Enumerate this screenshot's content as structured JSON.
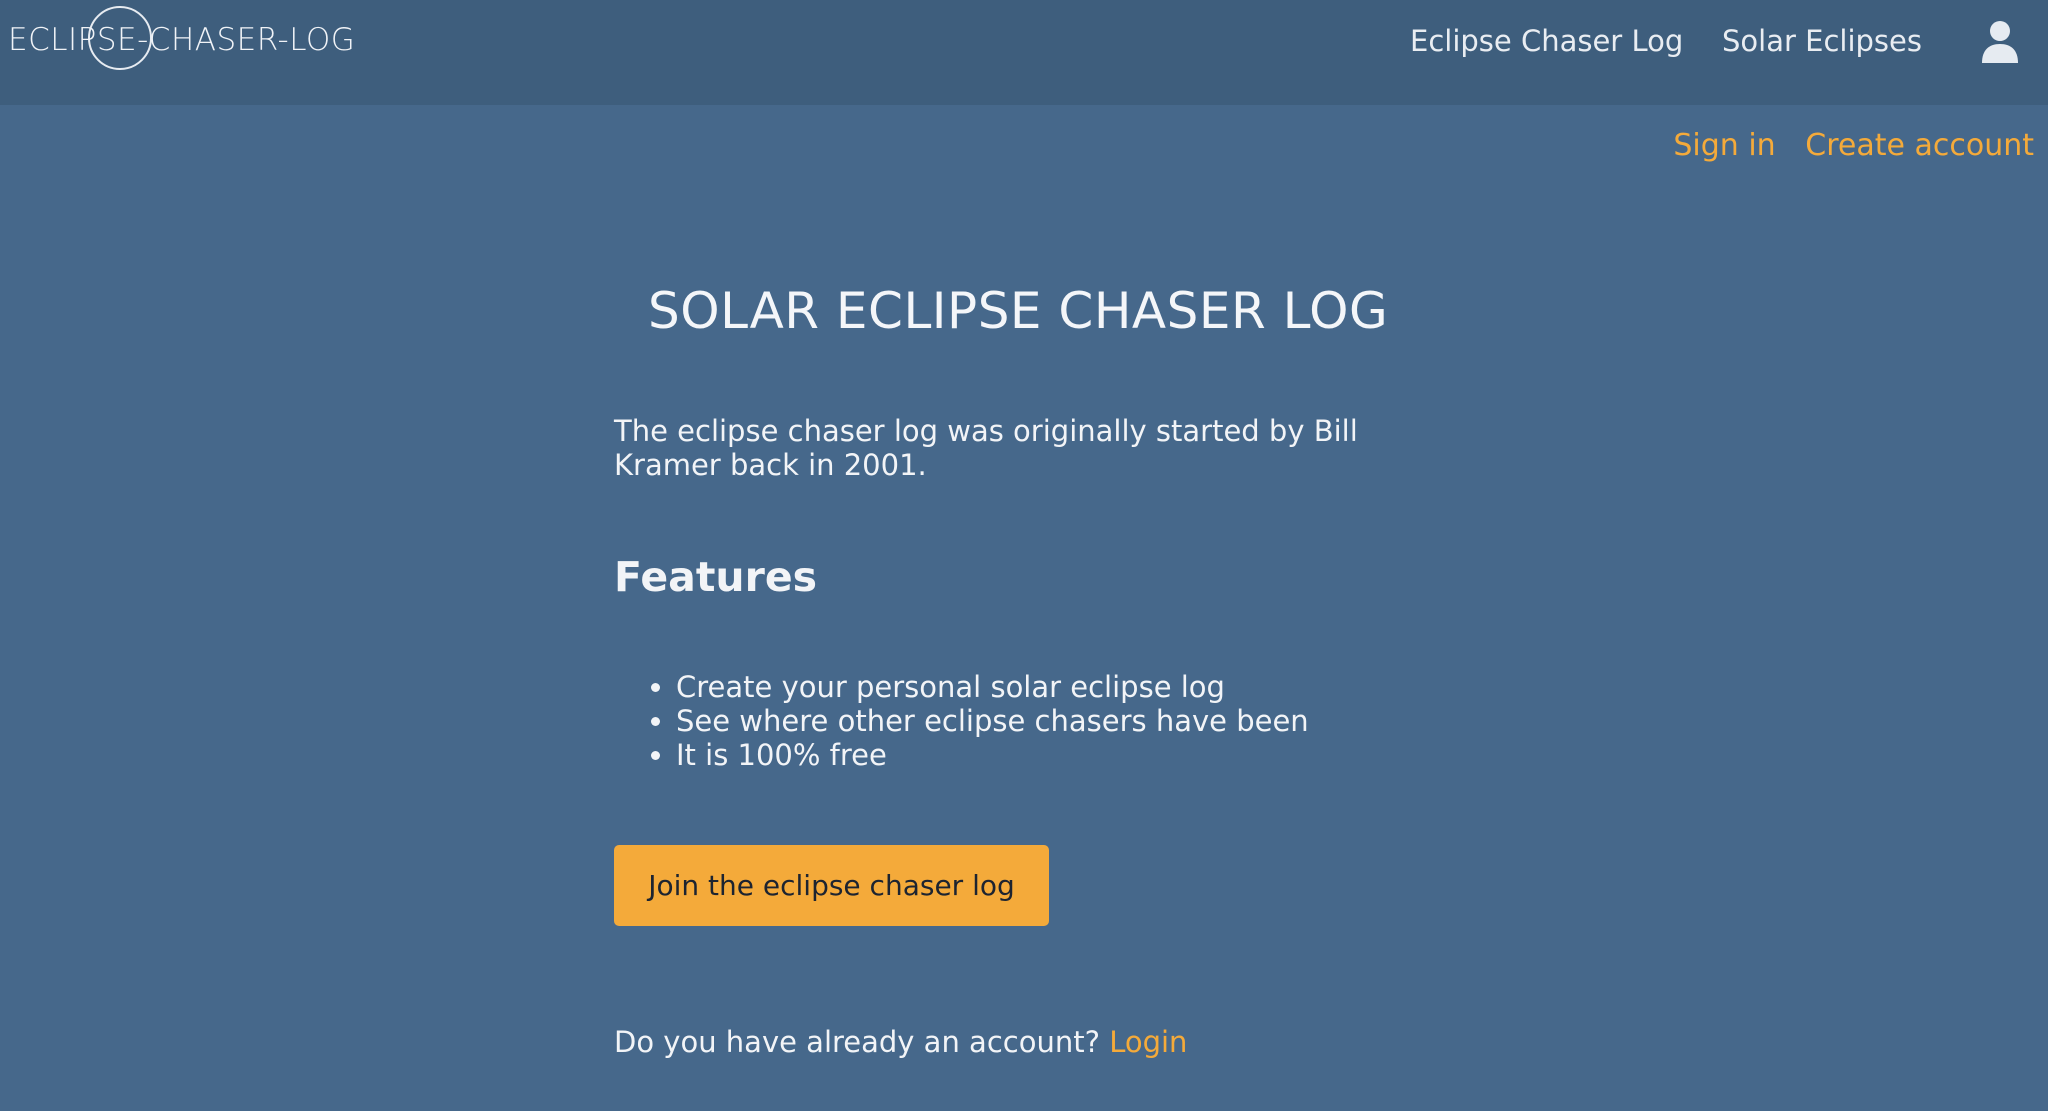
{
  "header": {
    "logo_text": [
      "ECLIPSE",
      "-CHASER-LOG"
    ],
    "nav": [
      {
        "label": "Eclipse Chaser Log"
      },
      {
        "label": "Solar Eclipses"
      }
    ],
    "user_icon": "user-icon"
  },
  "auth": {
    "sign_in": "Sign in",
    "create_account": "Create account"
  },
  "main": {
    "title": "SOLAR ECLIPSE CHASER LOG",
    "intro": "The eclipse chaser log was originally started by Bill Kramer back in 2001.",
    "features_heading": "Features",
    "features": [
      "Create your personal solar eclipse log",
      "See where other eclipse chasers have been",
      "It is 100% free"
    ],
    "join_button": "Join the eclipse chaser log",
    "login_prompt": "Do you have already an account?",
    "login_link": "Login"
  },
  "colors": {
    "background": "#46688b",
    "header": "#3e5e7d",
    "accent": "#f4aa3a"
  }
}
